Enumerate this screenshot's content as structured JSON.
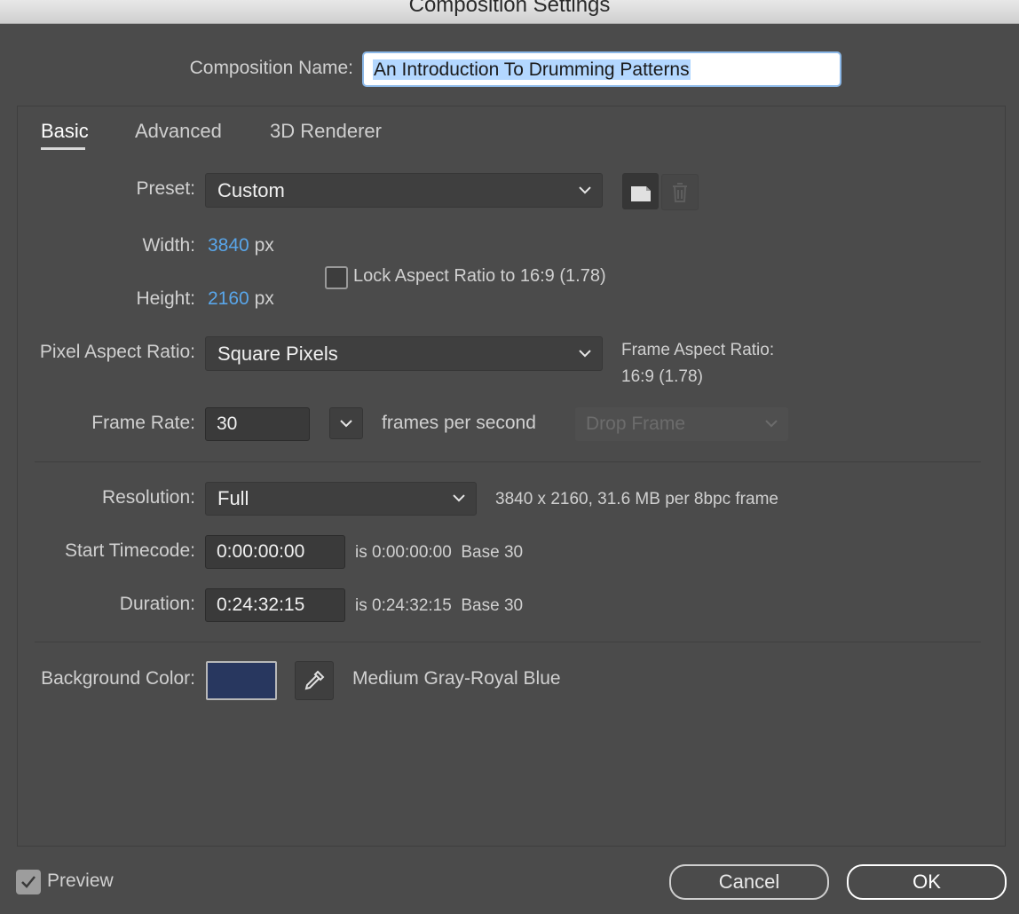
{
  "window": {
    "title": "Composition Settings"
  },
  "composition_name": {
    "label": "Composition Name:",
    "value": "An Introduction To Drumming Patterns"
  },
  "tabs": [
    {
      "label": "Basic",
      "active": true
    },
    {
      "label": "Advanced",
      "active": false
    },
    {
      "label": "3D Renderer",
      "active": false
    }
  ],
  "preset": {
    "label": "Preset:",
    "value": "Custom"
  },
  "width": {
    "label": "Width:",
    "value": "3840",
    "unit": "px"
  },
  "height": {
    "label": "Height:",
    "value": "2160",
    "unit": "px"
  },
  "lock_aspect": {
    "label": "Lock Aspect Ratio to 16:9 (1.78)",
    "checked": false
  },
  "pixel_aspect": {
    "label": "Pixel Aspect Ratio:",
    "value": "Square Pixels"
  },
  "frame_aspect": {
    "label": "Frame Aspect Ratio:",
    "value": "16:9 (1.78)"
  },
  "frame_rate": {
    "label": "Frame Rate:",
    "value": "30",
    "unit_label": "frames per second",
    "drop_frame": "Drop Frame"
  },
  "resolution": {
    "label": "Resolution:",
    "value": "Full",
    "info": "3840 x 2160, 31.6 MB per 8bpc frame"
  },
  "start_timecode": {
    "label": "Start Timecode:",
    "value": "0:00:00:00",
    "is_text": "is 0:00:00:00",
    "base": "Base 30"
  },
  "duration": {
    "label": "Duration:",
    "value": "0:24:32:15",
    "is_text": "is 0:24:32:15",
    "base": "Base 30"
  },
  "background": {
    "label": "Background Color:",
    "color": "#28375f",
    "color_name": "Medium Gray-Royal Blue"
  },
  "preview": {
    "label": "Preview",
    "checked": true
  },
  "buttons": {
    "cancel": "Cancel",
    "ok": "OK"
  },
  "colors": {
    "accent_blue": "#59a6ea",
    "selection": "#b3d7ff",
    "focus_ring": "#8bb8e8"
  }
}
